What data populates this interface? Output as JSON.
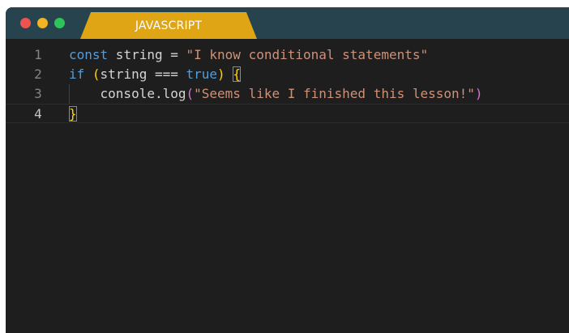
{
  "window": {
    "controls": [
      "close",
      "minimize",
      "maximize"
    ],
    "tab_label": "JAVASCRIPT"
  },
  "editor": {
    "line_numbers": [
      "1",
      "2",
      "3",
      "4"
    ],
    "current_line": 4,
    "line1": {
      "keyword": "const",
      "identifier": " string = ",
      "string": "\"I know conditional statements\""
    },
    "line2": {
      "keyword_if": "if",
      "space": " ",
      "paren_open": "(",
      "middle": "string === ",
      "keyword_true": "true",
      "paren_close": ")",
      "space2": " ",
      "brace_open": "{"
    },
    "line3": {
      "indent": "    ",
      "call": "console.log",
      "paren_open": "(",
      "string": "\"Seems like I finished this lesson!\"",
      "paren_close": ")"
    },
    "line4": {
      "brace_close": "}"
    }
  },
  "colors": {
    "titlebar": "#27434d",
    "tab": "#dfa514",
    "editor_bg": "#1e1e1e",
    "keyword": "#569cd6",
    "string": "#ce9178",
    "bracket_level1": "#ffd700",
    "bracket_level2": "#da70d6"
  }
}
